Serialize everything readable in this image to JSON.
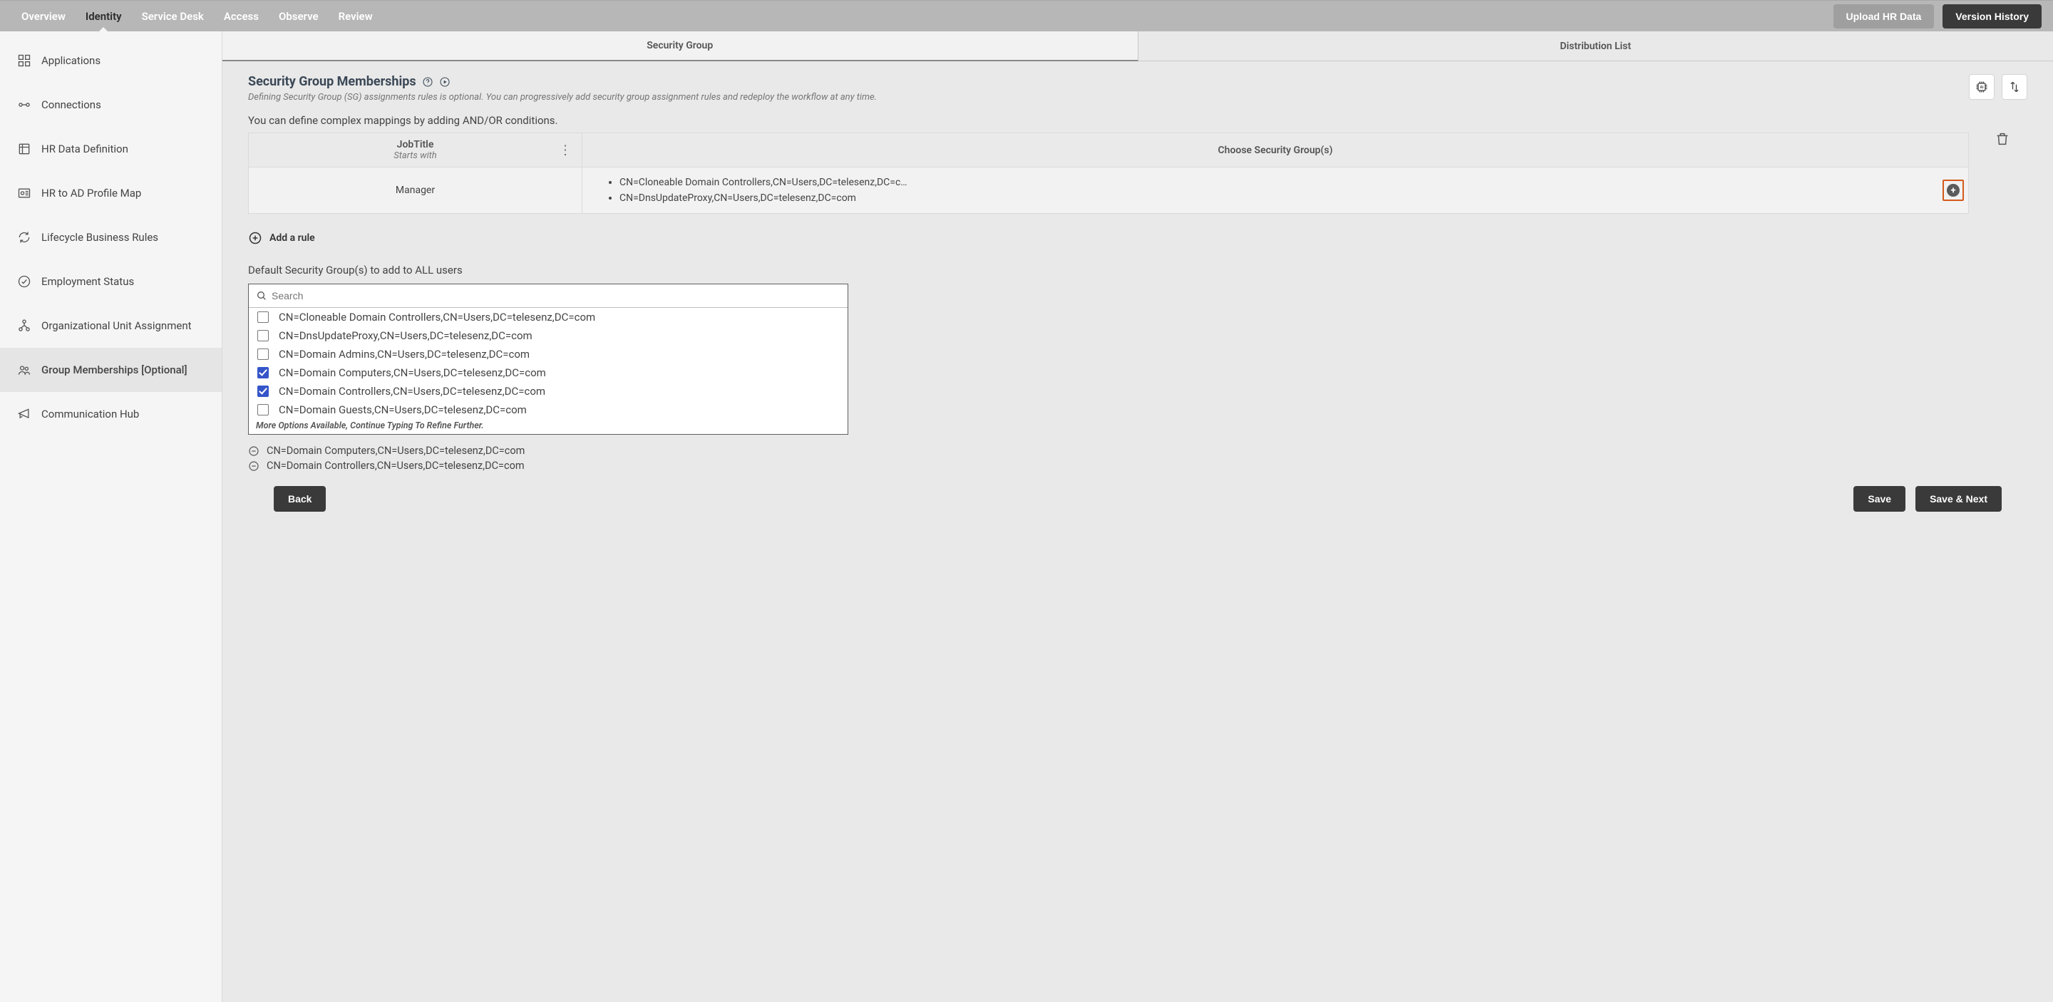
{
  "topnav": {
    "tabs": [
      "Overview",
      "Identity",
      "Service Desk",
      "Access",
      "Observe",
      "Review"
    ],
    "activeIndex": 1,
    "upload_btn": "Upload HR Data",
    "version_btn": "Version History"
  },
  "sidebar": {
    "items": [
      {
        "label": "Applications",
        "icon": "apps"
      },
      {
        "label": "Connections",
        "icon": "connections"
      },
      {
        "label": "HR Data Definition",
        "icon": "hr-data"
      },
      {
        "label": "HR to AD Profile Map",
        "icon": "profile-map"
      },
      {
        "label": "Lifecycle Business Rules",
        "icon": "lifecycle"
      },
      {
        "label": "Employment Status",
        "icon": "status"
      },
      {
        "label": "Organizational Unit Assignment",
        "icon": "ou"
      },
      {
        "label": "Group Memberships [Optional]",
        "icon": "groups"
      },
      {
        "label": "Communication Hub",
        "icon": "comm"
      }
    ],
    "activeIndex": 7
  },
  "innerTabs": {
    "items": [
      "Security Group",
      "Distribution List"
    ],
    "activeIndex": 0
  },
  "section": {
    "title": "Security Group Memberships",
    "subtitle": "Defining Security Group (SG) assignments rules is optional. You can progressively add security group assignment rules and redeploy the workflow at any time.",
    "note": "You can define complex mappings by adding AND/OR conditions."
  },
  "rule": {
    "field": "JobTitle",
    "operator": "Starts with",
    "header_right": "Choose Security Group(s)",
    "value": "Manager",
    "groups": [
      "CN=Cloneable Domain Controllers,CN=Users,DC=telesenz,DC=c…",
      "CN=DnsUpdateProxy,CN=Users,DC=telesenz,DC=com"
    ]
  },
  "add_rule_label": "Add a rule",
  "default_label": "Default Security Group(s) to add to ALL users",
  "dropdown": {
    "search_placeholder": "Search",
    "more_label": "More Options Available, Continue Typing To Refine Further.",
    "items": [
      {
        "label": "CN=Cloneable Domain Controllers,CN=Users,DC=telesenz,DC=com",
        "checked": false
      },
      {
        "label": "CN=DnsUpdateProxy,CN=Users,DC=telesenz,DC=com",
        "checked": false
      },
      {
        "label": "CN=Domain Admins,CN=Users,DC=telesenz,DC=com",
        "checked": false
      },
      {
        "label": "CN=Domain Computers,CN=Users,DC=telesenz,DC=com",
        "checked": true
      },
      {
        "label": "CN=Domain Controllers,CN=Users,DC=telesenz,DC=com",
        "checked": true
      },
      {
        "label": "CN=Domain Guests,CN=Users,DC=telesenz,DC=com",
        "checked": false
      }
    ]
  },
  "selected": [
    "CN=Domain Computers,CN=Users,DC=telesenz,DC=com",
    "CN=Domain Controllers,CN=Users,DC=telesenz,DC=com"
  ],
  "footer": {
    "back": "Back",
    "save": "Save",
    "save_next": "Save & Next"
  }
}
